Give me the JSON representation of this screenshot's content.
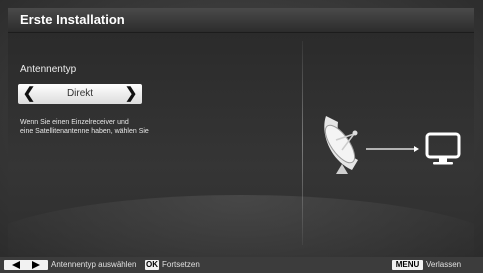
{
  "window": {
    "title": "Erste Installation"
  },
  "settings": {
    "field_label": "Antennentyp",
    "selector": {
      "value": "Direkt",
      "left_icon": "chevron-left-icon",
      "right_icon": "chevron-right-icon"
    },
    "hint_line1": "Wenn Sie einen Einzelreceiver und",
    "hint_line2": "eine Satellitenantenne haben, wählen Sie"
  },
  "illustration": {
    "icons": [
      "satellite-dish-icon",
      "arrow-right-icon",
      "tv-icon"
    ]
  },
  "footer": {
    "nav_icon": "left-right-arrows-icon",
    "nav_label": "Antennentyp auswählen",
    "ok_key": "OK",
    "ok_label": "Fortsetzen",
    "menu_key": "MENU",
    "menu_label": "Verlassen"
  },
  "colors": {
    "background": "#3a3a3a",
    "selector_background": "#ffffff",
    "text": "#ffffff"
  }
}
